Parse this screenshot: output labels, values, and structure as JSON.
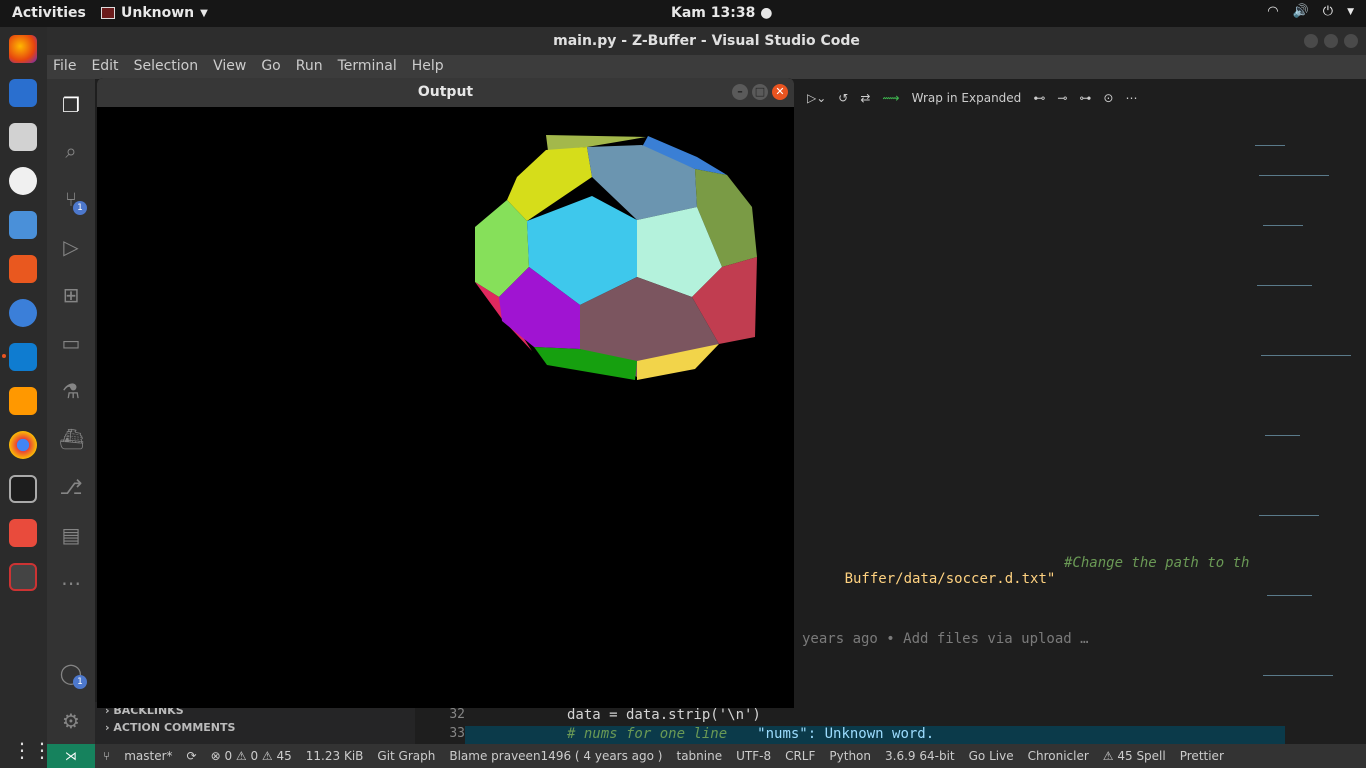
{
  "topbar": {
    "activities": "Activities",
    "app_name": "Unknown",
    "clock": "Kam 13:38 ●"
  },
  "vscode": {
    "window_title": "main.py - Z-Buffer - Visual Studio Code",
    "menu": [
      "File",
      "Edit",
      "Selection",
      "View",
      "Go",
      "Run",
      "Terminal",
      "Help"
    ],
    "scm_badge": "1",
    "accounts_badge": "1",
    "toolbar": {
      "wrap_label": "Wrap in Expanded"
    },
    "code": {
      "path_fragment": "Buffer/data/soccer.d.txt\"",
      "path_comment": "#Change the path to th",
      "blame_fragment": "years ago • Add files via upload …",
      "line_numbers": [
        "32",
        "33"
      ],
      "line_32": "data = data.strip('\\n')",
      "line_33": "# nums for one line",
      "diagnostic": "\"nums\": Unknown word."
    },
    "side_panel": {
      "backlinks": "BACKLINKS",
      "action_comments": "ACTION COMMENTS"
    },
    "statusbar": {
      "branch": "master*",
      "errors": "⊗ 0 ⚠ 0 ⚠ 45",
      "size": "11.23 KiB",
      "git_graph": "Git Graph",
      "blame": "Blame praveen1496 ( 4 years ago )",
      "tabnine": "tabnine",
      "encoding": "UTF-8",
      "eol": "CRLF",
      "language": "Python",
      "interpreter": "3.6.9 64-bit",
      "go_live": "Go Live",
      "chronicler": "Chronicler",
      "spell": "⚠ 45 Spell",
      "prettier": "Prettier"
    }
  },
  "output_window": {
    "title": "Output",
    "faces": [
      {
        "color": "#a3b84b"
      },
      {
        "color": "#3a7fd5"
      },
      {
        "color": "#d6dd1a"
      },
      {
        "color": "#6b95b0"
      },
      {
        "color": "#7a9b45"
      },
      {
        "color": "#86e05a"
      },
      {
        "color": "#3ec8ec"
      },
      {
        "color": "#b4f2dc"
      },
      {
        "color": "#c13d50"
      },
      {
        "color": "#e0295e"
      },
      {
        "color": "#a014d2"
      },
      {
        "color": "#7b555f"
      },
      {
        "color": "#16a00f"
      },
      {
        "color": "#f2d44a"
      }
    ]
  }
}
